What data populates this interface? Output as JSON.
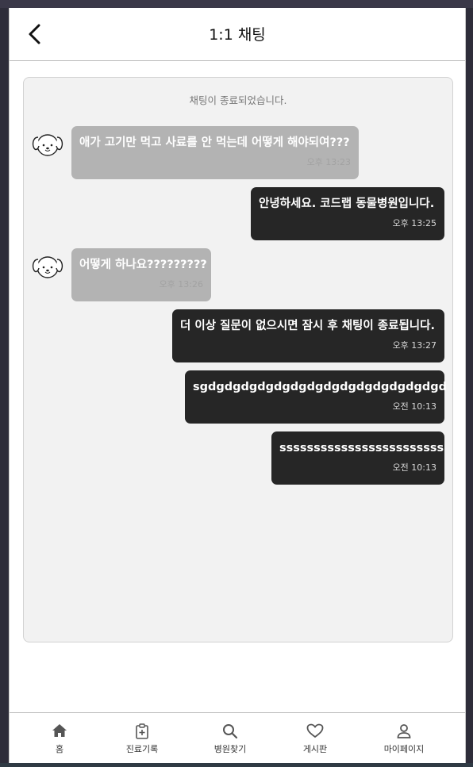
{
  "header": {
    "title": "1:1 채팅"
  },
  "chat": {
    "system_message": "채팅이 종료되었습니다.",
    "messages": [
      {
        "side": "left",
        "text": "애가 고기만 먹고 사료를 안 먹는데 어떻게 해야되여???",
        "time": "오후 13:23"
      },
      {
        "side": "right",
        "text": "안녕하세요. 코드랩 동물병원입니다.",
        "time": "오후 13:25"
      },
      {
        "side": "left",
        "text": "어떻게 하나요?????????",
        "time": "오후 13:26"
      },
      {
        "side": "right",
        "text": "더 이상 질문이 없으시면 잠시 후 채팅이 종료됩니다.",
        "time": "오후 13:27"
      },
      {
        "side": "right",
        "text": "sgdgdgdgdgdgdgdgdgdgdgdgdgdgdgd",
        "time": "오전 10:13"
      },
      {
        "side": "right",
        "text": "ssssssssssssssssssssssss",
        "time": "오전 10:13"
      }
    ]
  },
  "tabbar": {
    "items": [
      {
        "label": "홈",
        "icon": "home-icon"
      },
      {
        "label": "진료기록",
        "icon": "clipboard-plus-icon"
      },
      {
        "label": "병원찾기",
        "icon": "search-icon"
      },
      {
        "label": "게시판",
        "icon": "heart-icon"
      },
      {
        "label": "마이페이지",
        "icon": "user-icon"
      }
    ]
  },
  "colors": {
    "bubble_received": "#b3b3b3",
    "bubble_sent": "#262626",
    "panel_background": "#f2f2f2"
  }
}
